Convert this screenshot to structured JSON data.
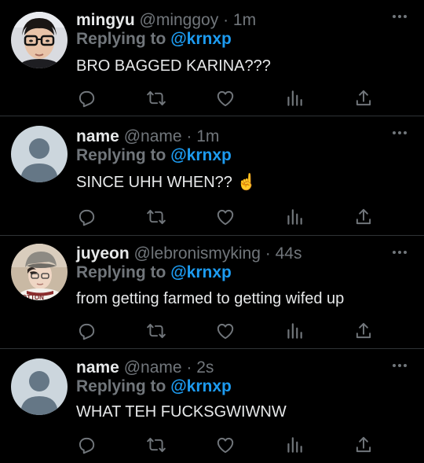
{
  "tweets": [
    {
      "display_name": "mingyu",
      "handle": "@minggoy",
      "separator": "·",
      "time": "1m",
      "reply_prefix": "Replying to",
      "reply_to": "@krnxp",
      "text": "BRO BAGGED KARINA???",
      "avatar": "photo"
    },
    {
      "display_name": "name",
      "handle": "@name",
      "separator": "·",
      "time": "1m",
      "reply_prefix": "Replying to",
      "reply_to": "@krnxp",
      "text": "SINCE UHH WHEN?? ☝️",
      "avatar": "default-profile-icon"
    },
    {
      "display_name": "juyeon",
      "handle": "@lebronismyking",
      "separator": "·",
      "time": "44s",
      "reply_prefix": "Replying to",
      "reply_to": "@krnxp",
      "text": "from getting farmed to getting wifed up",
      "avatar": "photo"
    },
    {
      "display_name": "name",
      "handle": "@name",
      "separator": "·",
      "time": "2s",
      "reply_prefix": "Replying to",
      "reply_to": "@krnxp",
      "text": "WHAT TEH FUCKSGWIWNW",
      "avatar": "default-profile-icon"
    }
  ],
  "icons": [
    "reply-icon",
    "retweet-icon",
    "like-icon",
    "views-icon",
    "share-icon",
    "more-options-icon"
  ],
  "colors": {
    "background": "#000000",
    "text": "#e7e9ea",
    "muted": "#71767b",
    "link": "#1d9bf0",
    "divider": "#2f3336",
    "default_avatar_bg": "#ccd6dd",
    "default_avatar_fg": "#657786"
  }
}
